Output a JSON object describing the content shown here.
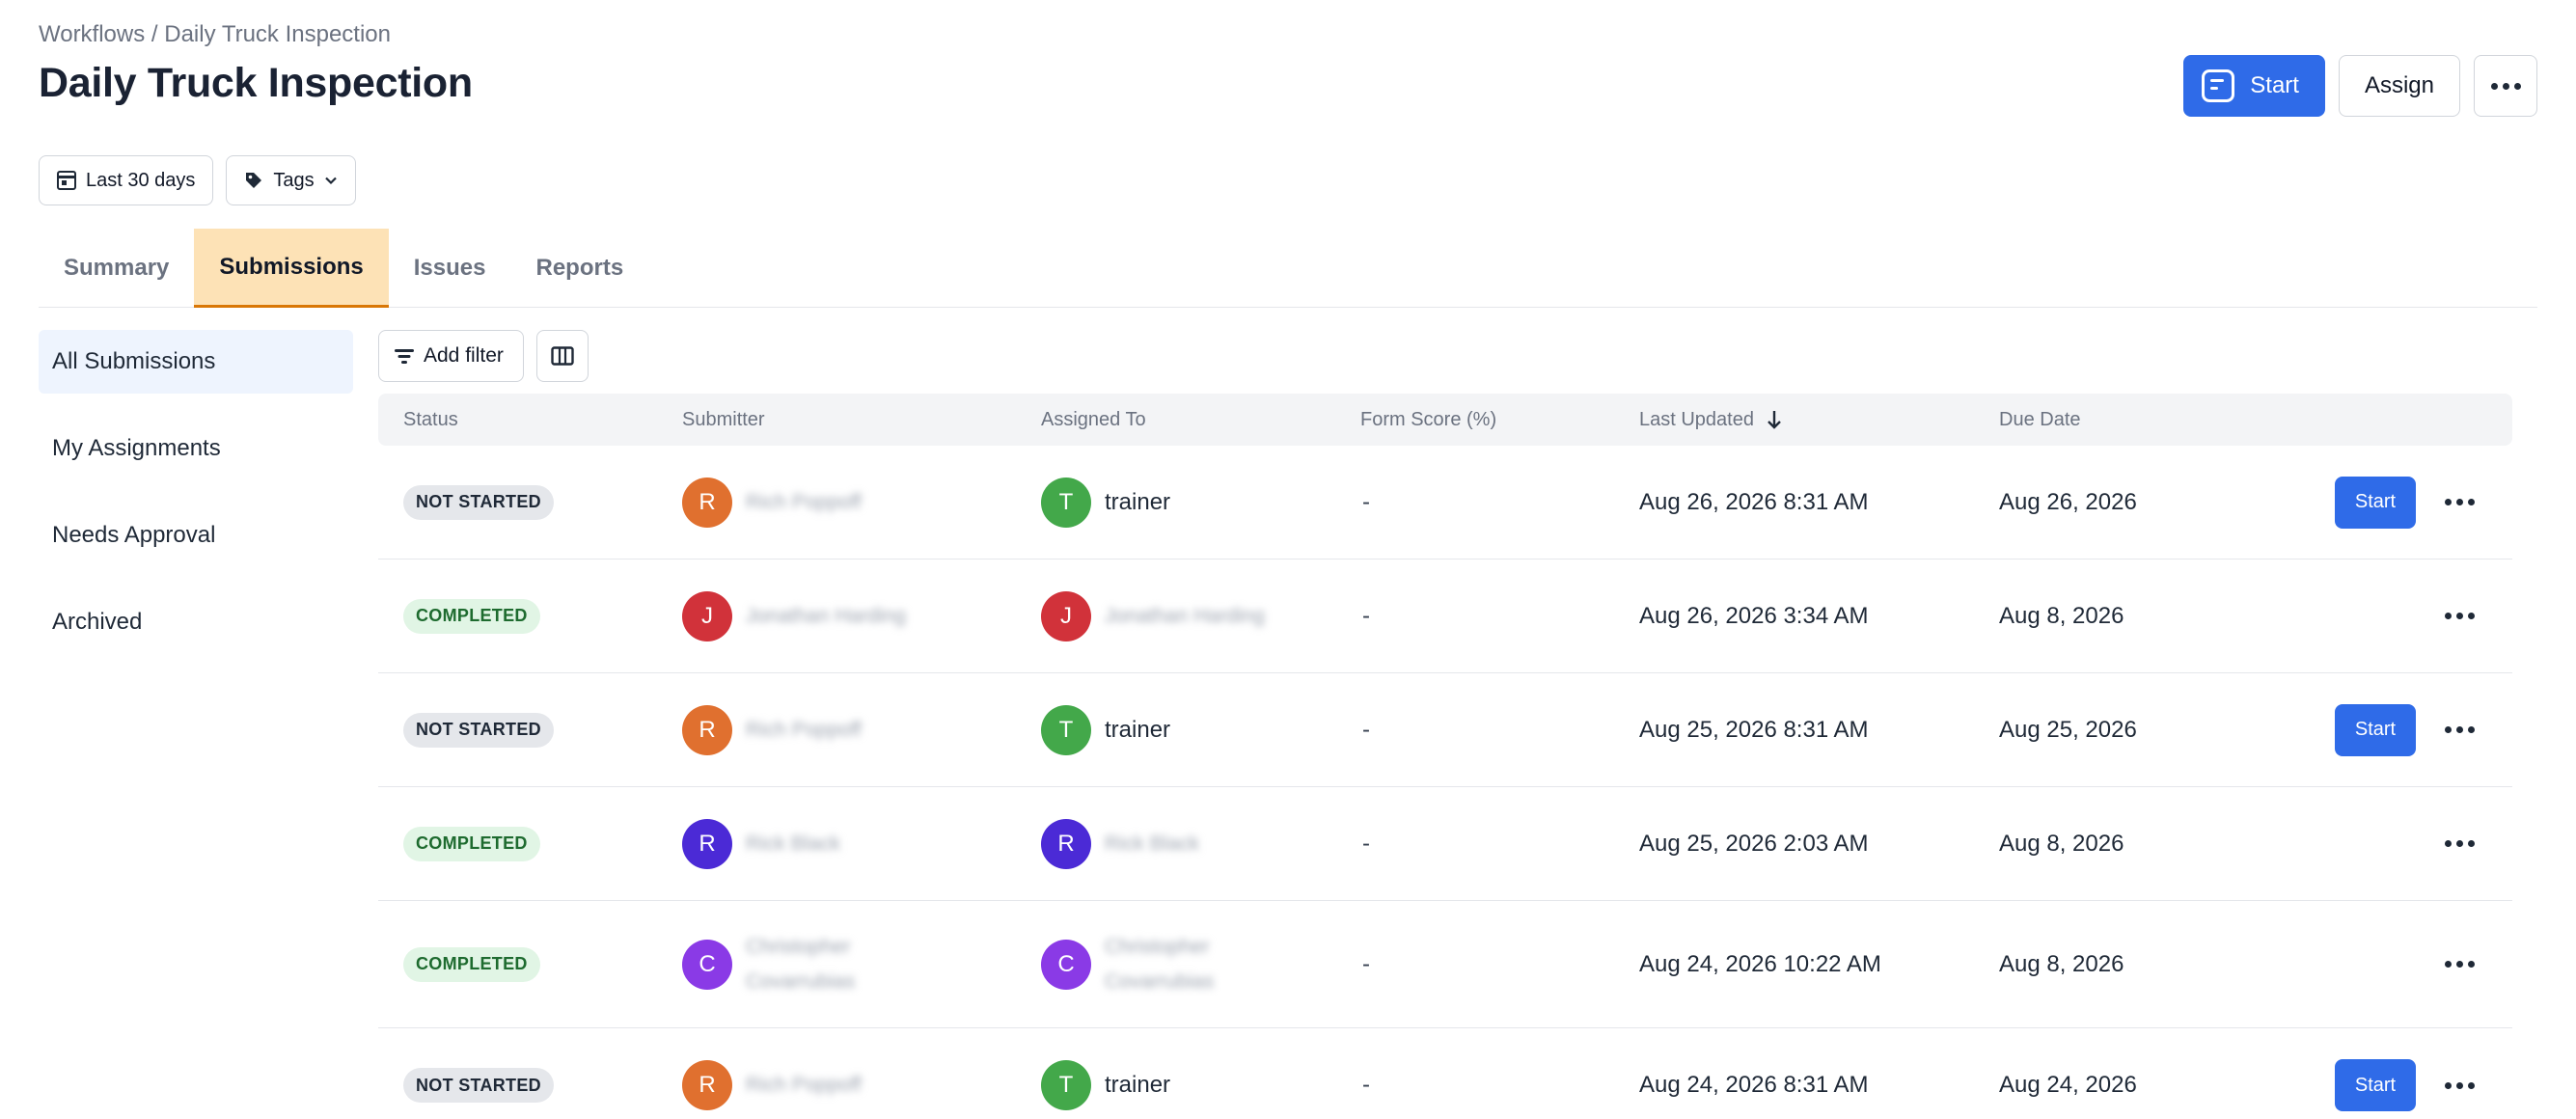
{
  "breadcrumb": "Workflows / Daily Truck Inspection",
  "title": "Daily Truck Inspection",
  "header_actions": {
    "start_label": "Start",
    "assign_label": "Assign"
  },
  "filters": {
    "date_range": "Last 30 days",
    "tags": "Tags"
  },
  "tabs": [
    {
      "label": "Summary",
      "active": false
    },
    {
      "label": "Submissions",
      "active": true
    },
    {
      "label": "Issues",
      "active": false
    },
    {
      "label": "Reports",
      "active": false
    }
  ],
  "sidebar": [
    {
      "label": "All Submissions",
      "active": true
    },
    {
      "label": "My Assignments",
      "active": false
    },
    {
      "label": "Needs Approval",
      "active": false
    },
    {
      "label": "Archived",
      "active": false
    }
  ],
  "toolbar": {
    "add_filter_label": "Add filter"
  },
  "table": {
    "columns": [
      "Status",
      "Submitter",
      "Assigned To",
      "Form Score (%)",
      "Last Updated",
      "Due Date"
    ],
    "rows": [
      {
        "status": "NOT STARTED",
        "submitter_initial": "R",
        "submitter_name": "Rich Poppoff",
        "submitter_color": "#e0702f",
        "assignee_initial": "T",
        "assignee_name": "trainer",
        "assignee_color": "#43a84a",
        "assignee_blurred": false,
        "score": "-",
        "last_updated": "Aug 26, 2026 8:31 AM",
        "due_date": "Aug 26, 2026",
        "start_label": "Start"
      },
      {
        "status": "COMPLETED",
        "submitter_initial": "J",
        "submitter_name": "Jonathan Harding",
        "submitter_color": "#d1323a",
        "assignee_initial": "J",
        "assignee_name": "Jonathan Harding",
        "assignee_color": "#d1323a",
        "assignee_blurred": true,
        "score": "-",
        "last_updated": "Aug 26, 2026 3:34 AM",
        "due_date": "Aug 8, 2026",
        "start_label": ""
      },
      {
        "status": "NOT STARTED",
        "submitter_initial": "R",
        "submitter_name": "Rich Poppoff",
        "submitter_color": "#e0702f",
        "assignee_initial": "T",
        "assignee_name": "trainer",
        "assignee_color": "#43a84a",
        "assignee_blurred": false,
        "score": "-",
        "last_updated": "Aug 25, 2026 8:31 AM",
        "due_date": "Aug 25, 2026",
        "start_label": "Start"
      },
      {
        "status": "COMPLETED",
        "submitter_initial": "R",
        "submitter_name": "Rick Black",
        "submitter_color": "#4b2ad6",
        "assignee_initial": "R",
        "assignee_name": "Rick Black",
        "assignee_color": "#4b2ad6",
        "assignee_blurred": true,
        "score": "-",
        "last_updated": "Aug 25, 2026 2:03 AM",
        "due_date": "Aug 8, 2026",
        "start_label": ""
      },
      {
        "status": "COMPLETED",
        "submitter_initial": "C",
        "submitter_name": "Christopher Covarrubias",
        "submitter_color": "#8a3ae6",
        "assignee_initial": "C",
        "assignee_name": "Christopher Covarrubias",
        "assignee_color": "#8a3ae6",
        "assignee_blurred": true,
        "score": "-",
        "last_updated": "Aug 24, 2026 10:22 AM",
        "due_date": "Aug 8, 2026",
        "start_label": ""
      },
      {
        "status": "NOT STARTED",
        "submitter_initial": "R",
        "submitter_name": "Rich Poppoff",
        "submitter_color": "#e0702f",
        "assignee_initial": "T",
        "assignee_name": "trainer",
        "assignee_color": "#43a84a",
        "assignee_blurred": false,
        "score": "-",
        "last_updated": "Aug 24, 2026 8:31 AM",
        "due_date": "Aug 24, 2026",
        "start_label": "Start"
      }
    ]
  },
  "colors": {
    "primary": "#2f6be8",
    "active_tab_bg": "#fde2b6",
    "active_tab_border": "#d97706",
    "sidebar_active_bg": "#eef4fe"
  },
  "icons": [
    "form-icon",
    "more-icon",
    "calendar-icon",
    "tag-icon",
    "chevron-down-icon",
    "filter-icon",
    "columns-icon",
    "sort-down-icon"
  ]
}
